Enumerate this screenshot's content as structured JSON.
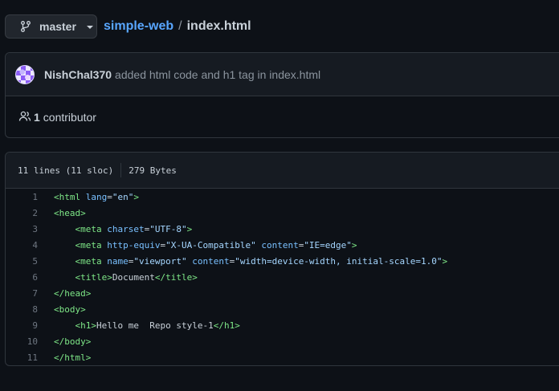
{
  "branch": {
    "name": "master"
  },
  "breadcrumb": {
    "repo": "simple-web",
    "separator": "/",
    "file": "index.html"
  },
  "commit": {
    "author": "NishChal370",
    "message": "added html code and h1 tag in index.html"
  },
  "contributors": {
    "count": "1",
    "label": "contributor"
  },
  "file": {
    "lines_info": "11 lines (11 sloc)",
    "size": "279 Bytes",
    "lines": [
      {
        "n": "1",
        "indent": "",
        "tokens": [
          [
            "tag",
            "<html "
          ],
          [
            "attr",
            "lang"
          ],
          [
            "txt",
            "="
          ],
          [
            "str",
            "\"en\""
          ],
          [
            "tag",
            ">"
          ]
        ]
      },
      {
        "n": "2",
        "indent": "",
        "tokens": [
          [
            "tag",
            "<head>"
          ]
        ]
      },
      {
        "n": "3",
        "indent": "    ",
        "tokens": [
          [
            "tag",
            "<meta "
          ],
          [
            "attr",
            "charset"
          ],
          [
            "txt",
            "="
          ],
          [
            "str",
            "\"UTF-8\""
          ],
          [
            "tag",
            ">"
          ]
        ]
      },
      {
        "n": "4",
        "indent": "    ",
        "tokens": [
          [
            "tag",
            "<meta "
          ],
          [
            "attr",
            "http-equiv"
          ],
          [
            "txt",
            "="
          ],
          [
            "str",
            "\"X-UA-Compatible\""
          ],
          [
            "txt",
            " "
          ],
          [
            "attr",
            "content"
          ],
          [
            "txt",
            "="
          ],
          [
            "str",
            "\"IE=edge\""
          ],
          [
            "tag",
            ">"
          ]
        ]
      },
      {
        "n": "5",
        "indent": "    ",
        "tokens": [
          [
            "tag",
            "<meta "
          ],
          [
            "attr",
            "name"
          ],
          [
            "txt",
            "="
          ],
          [
            "str",
            "\"viewport\""
          ],
          [
            "txt",
            " "
          ],
          [
            "attr",
            "content"
          ],
          [
            "txt",
            "="
          ],
          [
            "str",
            "\"width=device-width, initial-scale=1.0\""
          ],
          [
            "tag",
            ">"
          ]
        ]
      },
      {
        "n": "6",
        "indent": "    ",
        "tokens": [
          [
            "tag",
            "<title>"
          ],
          [
            "txt",
            "Document"
          ],
          [
            "tag",
            "</title>"
          ]
        ]
      },
      {
        "n": "7",
        "indent": "",
        "tokens": [
          [
            "tag",
            "</head>"
          ]
        ]
      },
      {
        "n": "8",
        "indent": "",
        "tokens": [
          [
            "tag",
            "<body>"
          ]
        ]
      },
      {
        "n": "9",
        "indent": "    ",
        "tokens": [
          [
            "tag",
            "<h1>"
          ],
          [
            "txt",
            "Hello me  Repo style-1"
          ],
          [
            "tag",
            "</h1>"
          ]
        ]
      },
      {
        "n": "10",
        "indent": "",
        "tokens": [
          [
            "tag",
            "</body>"
          ]
        ]
      },
      {
        "n": "11",
        "indent": "",
        "tokens": [
          [
            "tag",
            "</html>"
          ]
        ]
      }
    ]
  },
  "icons": {
    "branch": "git-branch-icon",
    "caret": "triangle-down-icon",
    "people": "people-icon"
  },
  "colors": {
    "background": "#0d1117",
    "link": "#58a6ff",
    "tag": "#7ee787",
    "attr": "#79c0ff",
    "string": "#a5d6ff"
  }
}
